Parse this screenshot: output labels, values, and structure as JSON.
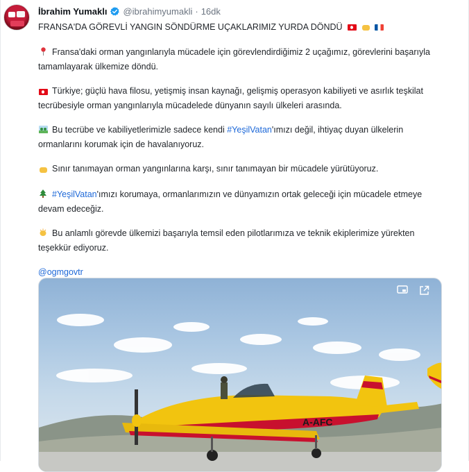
{
  "tweet": {
    "author_name": "İbrahim Yumaklı",
    "handle": "@ibrahimyumakli",
    "separator": "·",
    "time": "16dk",
    "title": "FRANSA'DA GÖREVLİ YANGIN SÖNDÜRME UÇAKLARIMIZ YURDA DÖNDÜ",
    "paragraphs": [
      {
        "icon": "pin-icon",
        "text": "Fransa'daki orman yangınlarıyla mücadele için görevlendirdiğimiz 2 uçağımız, görevlerini başarıyla tamamlayarak ülkemize döndü."
      },
      {
        "icon": "turkey-flag-icon",
        "text": "Türkiye; güçlü hava filosu, yetişmiş insan kaynağı, gelişmiş operasyon kabiliyeti ve asırlık teşkilat tecrübesiyle orman yangınlarıyla mücadelede dünyanın sayılı ülkeleri arasında."
      },
      {
        "icon": "park-icon",
        "before": "Bu tecrübe ve kabiliyetlerimizle sadece kendi ",
        "hashtag": "#YeşilVatan",
        "after": "'ımızı değil, ihtiyaç duyan ülkelerin ormanlarını korumak için de havalanıyoruz."
      },
      {
        "icon": "handshake-icon",
        "text": "Sınır tanımayan orman yangınlarına karşı, sınır tanımayan bir mücadele yürütüyoruz."
      },
      {
        "icon": "tree-icon",
        "hashtag": "#YeşilVatan",
        "after": "'ımızı korumaya, ormanlarımızın ve dünyamızın ortak geleceği için mücadele etmeye devam edeceğiz."
      },
      {
        "icon": "clapping-hands-icon",
        "text": "Bu anlamlı görevde ülkemizi başarıyla temsil eden pilotlarımıza ve teknik ekiplerimize yürekten teşekkür ediyoruz."
      }
    ],
    "mention": "@ogmgovtr",
    "media": {
      "aircraft_reg": "A-AFC",
      "colors": {
        "aircraft": "#f2c40f",
        "aircraft_red": "#c8102e",
        "sky": "#a9c6e2"
      }
    }
  },
  "colors": {
    "link": "#1d68d8",
    "muted": "#6b7480",
    "verified": "#1d9bf0"
  }
}
